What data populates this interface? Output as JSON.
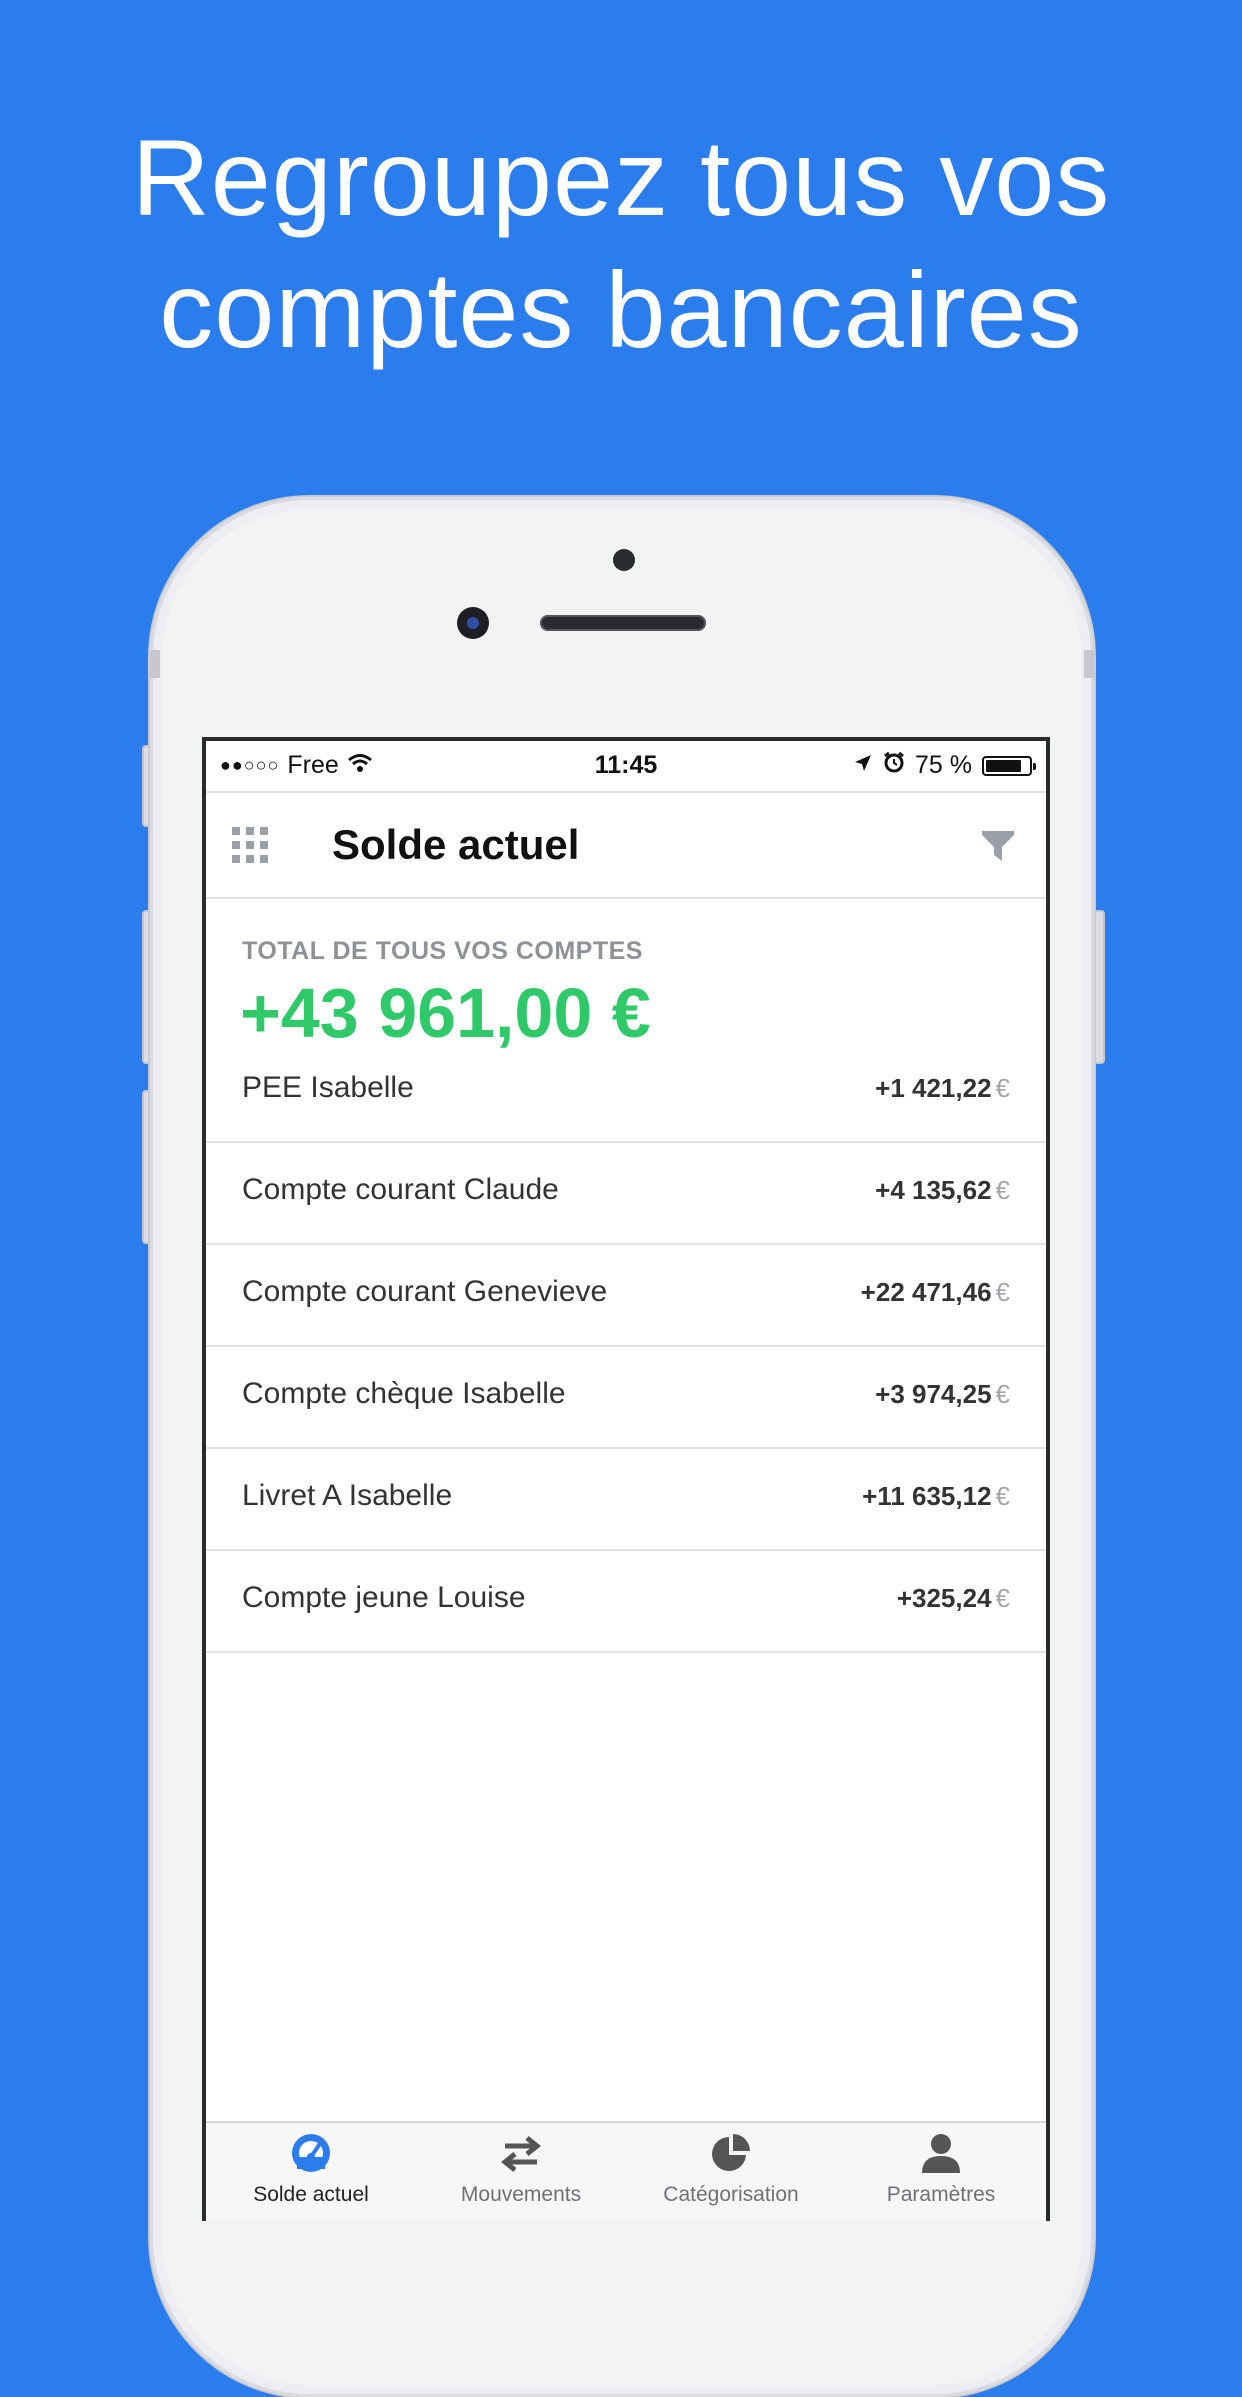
{
  "headline": {
    "line1": "Regroupez tous vos",
    "line2": "comptes bancaires"
  },
  "status_bar": {
    "signal": "●●○○○",
    "carrier": "Free",
    "time": "11:45",
    "battery_percent": "75 %",
    "battery_level": 0.75
  },
  "nav": {
    "title": "Solde actuel"
  },
  "summary": {
    "label": "TOTAL DE TOUS VOS COMPTES",
    "value": "+43 961,00 €"
  },
  "accounts": [
    {
      "name": "PEE Isabelle",
      "amount": "+1 421,22",
      "currency": "€"
    },
    {
      "name": "Compte courant Claude",
      "amount": "+4 135,62",
      "currency": "€"
    },
    {
      "name": "Compte courant Genevieve",
      "amount": "+22 471,46",
      "currency": "€"
    },
    {
      "name": "Compte chèque Isabelle",
      "amount": "+3 974,25",
      "currency": "€"
    },
    {
      "name": "Livret A Isabelle",
      "amount": "+11 635,12",
      "currency": "€"
    },
    {
      "name": "Compte jeune Louise",
      "amount": "+325,24",
      "currency": "€"
    }
  ],
  "tabs": [
    {
      "label": "Solde actuel",
      "icon": "gauge-icon",
      "active": true
    },
    {
      "label": "Mouvements",
      "icon": "transfer-arrows-icon",
      "active": false
    },
    {
      "label": "Catégorisation",
      "icon": "pie-chart-icon",
      "active": false
    },
    {
      "label": "Paramètres",
      "icon": "user-icon",
      "active": false
    }
  ],
  "colors": {
    "background": "#2b7ced",
    "positive_total": "#2fc96a",
    "active_tab": "#2b7ced"
  }
}
